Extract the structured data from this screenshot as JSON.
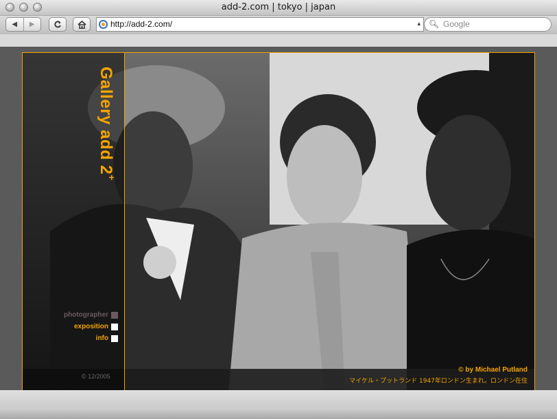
{
  "window": {
    "title": "add-2.com | tokyo | japan"
  },
  "toolbar": {
    "back_icon": "back-arrow-icon",
    "forward_icon": "forward-arrow-icon",
    "reload_icon": "reload-icon",
    "home_icon": "home-icon",
    "url": "http://add-2.com/",
    "search_placeholder": "Google"
  },
  "gallery": {
    "logo_main": "Gallery add 2",
    "logo_sup": "+",
    "menu": [
      {
        "label": "photographer",
        "color": "#6b5a62"
      },
      {
        "label": "exposition",
        "color": "#f5a400"
      },
      {
        "label": "info",
        "color": "#f5a400"
      }
    ],
    "copyright_left": "© 12/2005",
    "credit": "© by Michael Putland",
    "credit_jp": "マイケル・プットランド 1947年ロンドン生まれ。ロンドン在住"
  },
  "colors": {
    "accent": "#f5a400",
    "background": "#5a5a5a"
  }
}
